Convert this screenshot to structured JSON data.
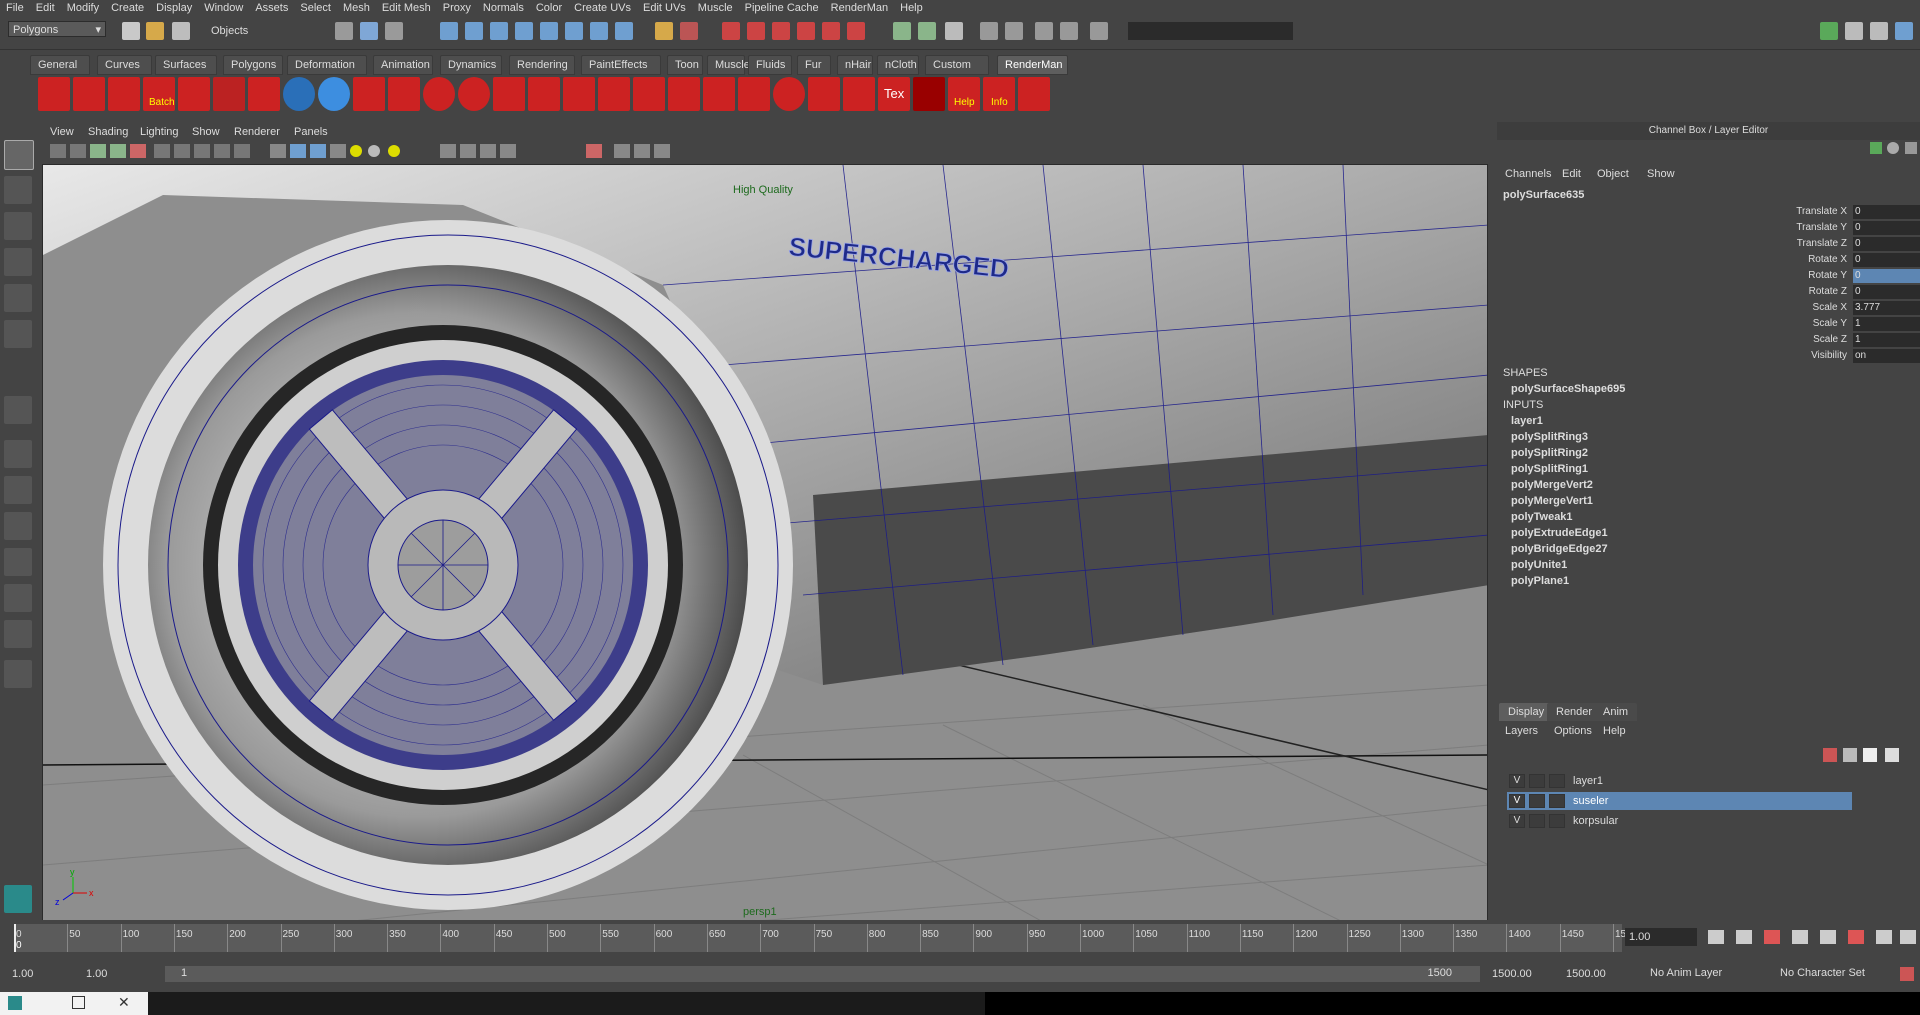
{
  "menus": [
    "File",
    "Edit",
    "Modify",
    "Create",
    "Display",
    "Window",
    "Assets",
    "Select",
    "Mesh",
    "Edit Mesh",
    "Proxy",
    "Normals",
    "Color",
    "Create UVs",
    "Edit UVs",
    "Muscle",
    "Pipeline Cache",
    "RenderMan",
    "Help"
  ],
  "status": {
    "mode": "Polygons",
    "select_mode": "Objects"
  },
  "shelf_tabs": [
    "General",
    "Curves",
    "Surfaces",
    "Polygons",
    "Deformation",
    "Animation",
    "Dynamics",
    "Rendering",
    "PaintEffects",
    "Toon",
    "Muscle",
    "Fluids",
    "Fur",
    "nHair",
    "nCloth",
    "Custom",
    "RenderMan"
  ],
  "shelf_labels": {
    "batch": "Batch",
    "tex": "Tex",
    "help": "Help",
    "info": "Info"
  },
  "viewport": {
    "menus": [
      "View",
      "Shading",
      "Lighting",
      "Show",
      "Renderer",
      "Panels"
    ],
    "hud_quality": "High Quality",
    "camera": "persp1",
    "decal_text": "SUPERCHARGED",
    "axis": {
      "x": "x",
      "y": "y",
      "z": "z"
    }
  },
  "channel_box": {
    "title": "Channel Box / Layer Editor",
    "menus": [
      "Channels",
      "Edit",
      "Object",
      "Show"
    ],
    "object": "polySurface635",
    "attributes": [
      {
        "label": "Translate X",
        "value": "0"
      },
      {
        "label": "Translate Y",
        "value": "0"
      },
      {
        "label": "Translate Z",
        "value": "0"
      },
      {
        "label": "Rotate X",
        "value": "0"
      },
      {
        "label": "Rotate Y",
        "value": "0"
      },
      {
        "label": "Rotate Z",
        "value": "0"
      },
      {
        "label": "Scale X",
        "value": "3.777"
      },
      {
        "label": "Scale Y",
        "value": "1"
      },
      {
        "label": "Scale Z",
        "value": "1"
      },
      {
        "label": "Visibility",
        "value": "on"
      }
    ],
    "shapes_header": "SHAPES",
    "shape": "polySurfaceShape695",
    "inputs_header": "INPUTS",
    "inputs": [
      "layer1",
      "polySplitRing3",
      "polySplitRing2",
      "polySplitRing1",
      "polyMergeVert2",
      "polyMergeVert1",
      "polyTweak1",
      "polyExtrudeEdge1",
      "polyBridgeEdge27",
      "polyUnite1",
      "polyPlane1"
    ]
  },
  "layer_editor": {
    "tabs": [
      "Display",
      "Render",
      "Anim"
    ],
    "menus": [
      "Layers",
      "Options",
      "Help"
    ],
    "layers": [
      {
        "v": "V",
        "name": "layer1",
        "selected": false
      },
      {
        "v": "V",
        "name": "suseler",
        "selected": true
      },
      {
        "v": "V",
        "name": "korpsular",
        "selected": false
      }
    ]
  },
  "timeline": {
    "ticks": [
      "0",
      "50",
      "100",
      "150",
      "200",
      "250",
      "300",
      "350",
      "400",
      "450",
      "500",
      "550",
      "600",
      "650",
      "700",
      "750",
      "800",
      "850",
      "900",
      "950",
      "1000",
      "1050",
      "1100",
      "1150",
      "1200",
      "1250",
      "1300",
      "1350",
      "1400",
      "1450",
      "15"
    ],
    "current_frame_marker": "0",
    "current_time": "1.00"
  },
  "range": {
    "start": "1.00",
    "playback_start": "1.00",
    "slider_start": "1",
    "slider_end": "1500",
    "playback_end": "1500.00",
    "end": "1500.00",
    "anim_layer": "No Anim Layer",
    "character_set": "No Character Set"
  }
}
